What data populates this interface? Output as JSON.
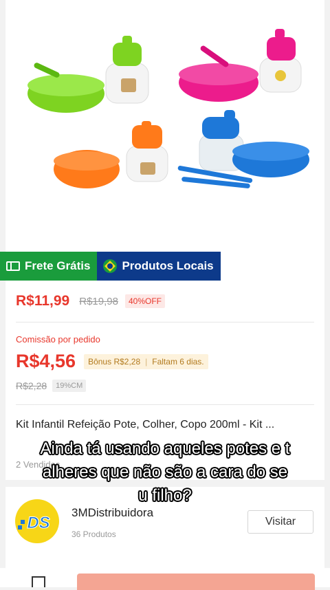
{
  "badges": {
    "frete_label": "Frete Grátis",
    "locais_label": "Produtos Locais",
    "frete_color": "#1a9c3c",
    "locais_color": "#0d3a8a"
  },
  "pricing": {
    "price": "R$11,99",
    "old_price": "R$19,98",
    "discount": "40%OFF"
  },
  "commission": {
    "label": "Comissão por pedido",
    "value": "R$4,56",
    "bonus": "Bônus R$2,28",
    "remaining": "Faltam 6 dias.",
    "old_value": "R$2,28",
    "rate": "19%CM"
  },
  "product": {
    "title": "Kit Infantil Refeição Pote, Colher, Copo 200ml - Kit ...",
    "sold": "2 Vendidos"
  },
  "store": {
    "name": "3MDistribuidora",
    "count": "36 Produtos",
    "logo_text": "DS",
    "visit_label": "Visitar"
  },
  "caption": {
    "line1": "Ainda tá usando aqueles potes e t",
    "line2": "alheres que não são a cara do se",
    "line3": "u filho?"
  },
  "colors": {
    "accent": "#e8372c",
    "cta": "#f4a593"
  }
}
